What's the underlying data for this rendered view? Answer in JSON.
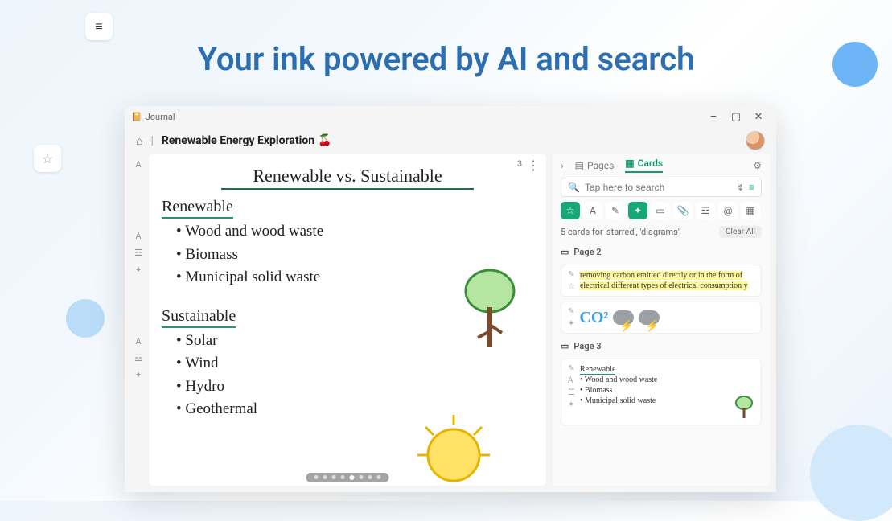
{
  "hero": {
    "title": "Your ink powered by AI and search"
  },
  "window": {
    "app_name": "Journal",
    "min_label": "–",
    "max_label": "▢",
    "close_label": "✕"
  },
  "breadcrumb": {
    "separator": "|",
    "title": "Renewable Energy Exploration",
    "emoji": "🍒"
  },
  "canvas": {
    "corner_count": "3",
    "heading": "Renewable vs. Sustainable",
    "sections": [
      {
        "title": "Renewable",
        "items": [
          "Wood and wood waste",
          "Biomass",
          "Municipal solid waste"
        ]
      },
      {
        "title": "Sustainable",
        "items": [
          "Solar",
          "Wind",
          "Hydro",
          "Geothermal"
        ]
      }
    ],
    "page_dots": {
      "count": 8,
      "active": 4
    }
  },
  "panel": {
    "tabs": {
      "pages": "Pages",
      "cards": "Cards"
    },
    "search": {
      "placeholder": "Tap here to search"
    },
    "filter_icons": [
      "star",
      "text",
      "pen",
      "tag",
      "page",
      "clip",
      "list",
      "at",
      "cal"
    ],
    "results_text": "5 cards for 'starred', 'diagrams'",
    "clear_label": "Clear All",
    "pages": [
      {
        "label": "Page 2",
        "cards": [
          {
            "side": [
              "pen",
              "star"
            ],
            "hl": true,
            "text": "removing carbon emitted directly or in the form of electrical different types of electrical consumption y"
          },
          {
            "side": [
              "pen",
              "tag"
            ],
            "co2": "CO²"
          }
        ]
      },
      {
        "label": "Page 3",
        "cards": [
          {
            "side": [
              "pen",
              "text",
              "list",
              "tag"
            ],
            "mini": true,
            "title": "Renewable",
            "lines": [
              "Wood and wood waste",
              "Biomass",
              "Municipal solid waste"
            ]
          }
        ]
      }
    ]
  },
  "icons": {
    "hamburger": "≡",
    "star_outline": "☆",
    "home": "⌂",
    "journal": "📔",
    "collapse": "›",
    "pages": "▤",
    "cards": "▦",
    "tune": "⚙",
    "search": "🔍",
    "mic": "↯",
    "filter": "≡",
    "more": "⋮",
    "text": "A",
    "pen": "✎",
    "tag": "✦",
    "page": "▭",
    "clip": "📎",
    "list": "☲",
    "at": "@",
    "cal": "▦",
    "doc": "▭"
  }
}
